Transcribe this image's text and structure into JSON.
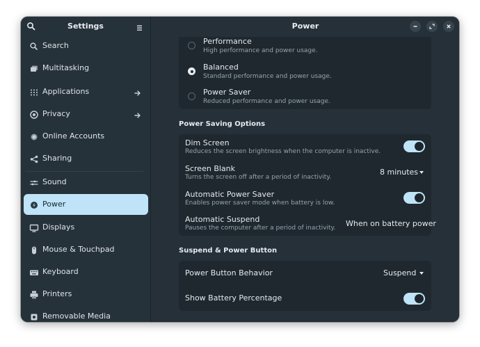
{
  "sidebar": {
    "title": "Settings",
    "items": [
      {
        "label": "Search",
        "icon": "search-icon"
      },
      {
        "label": "Multitasking",
        "icon": "multitasking-icon"
      },
      {
        "label": "Applications",
        "icon": "applications-icon"
      },
      {
        "label": "Privacy",
        "icon": "privacy-icon"
      },
      {
        "label": "Online Accounts",
        "icon": "online-accounts-icon"
      },
      {
        "label": "Sharing",
        "icon": "sharing-icon"
      },
      {
        "label": "Sound",
        "icon": "sound-icon"
      },
      {
        "label": "Power",
        "icon": "power-icon",
        "active": true
      },
      {
        "label": "Displays",
        "icon": "displays-icon"
      },
      {
        "label": "Mouse & Touchpad",
        "icon": "mouse-icon"
      },
      {
        "label": "Keyboard",
        "icon": "keyboard-icon"
      },
      {
        "label": "Printers",
        "icon": "printer-icon"
      },
      {
        "label": "Removable Media",
        "icon": "removable-media-icon"
      }
    ]
  },
  "main": {
    "title": "Power",
    "power_mode": [
      {
        "title": "Performance",
        "subtitle": "High performance and power usage.",
        "selected": false
      },
      {
        "title": "Balanced",
        "subtitle": "Standard performance and power usage.",
        "selected": true
      },
      {
        "title": "Power Saver",
        "subtitle": "Reduced performance and power usage.",
        "selected": false
      }
    ],
    "power_saving": {
      "heading": "Power Saving Options",
      "dim_screen": {
        "title": "Dim Screen",
        "subtitle": "Reduces the screen brightness when the computer is inactive.",
        "enabled": true
      },
      "screen_blank": {
        "title": "Screen Blank",
        "subtitle": "Turns the screen off after a period of inactivity.",
        "value": "8 minutes"
      },
      "auto_power_saver": {
        "title": "Automatic Power Saver",
        "subtitle": "Enables power saver mode when battery is low.",
        "enabled": true
      },
      "auto_suspend": {
        "title": "Automatic Suspend",
        "subtitle": "Pauses the computer after a period of inactivity.",
        "value": "When on battery power"
      }
    },
    "suspend": {
      "heading": "Suspend & Power Button",
      "power_button": {
        "title": "Power Button Behavior",
        "value": "Suspend"
      },
      "battery_pct": {
        "title": "Show Battery Percentage",
        "enabled": true
      }
    }
  },
  "colors": {
    "accent": "#bfe3f7",
    "window_bg": "#263038",
    "card_bg": "#1f282f"
  }
}
